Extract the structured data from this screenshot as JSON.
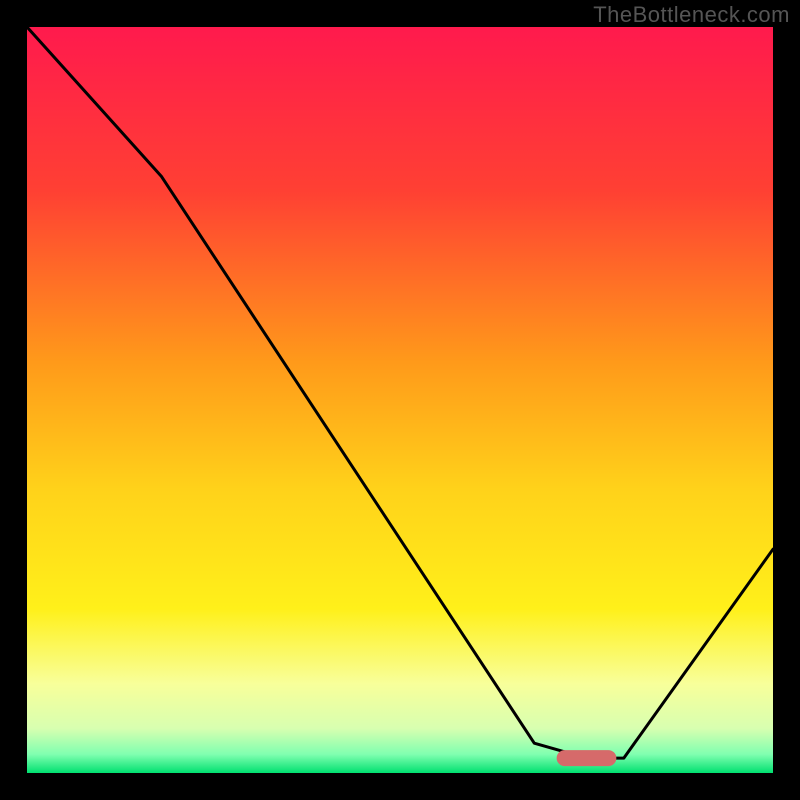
{
  "watermark": "TheBottleneck.com",
  "chart_data": {
    "type": "line",
    "title": "",
    "xlabel": "",
    "ylabel": "",
    "xlim": [
      0,
      100
    ],
    "ylim": [
      0,
      100
    ],
    "x": [
      0,
      18,
      68,
      75,
      80,
      100
    ],
    "values": [
      100,
      80,
      4,
      2,
      2,
      30
    ],
    "marker": {
      "x_start": 71,
      "x_end": 79,
      "y": 2
    },
    "gradient_stops": [
      {
        "offset": 0.0,
        "color": "#ff1a4d"
      },
      {
        "offset": 0.22,
        "color": "#ff4033"
      },
      {
        "offset": 0.45,
        "color": "#ff9a1a"
      },
      {
        "offset": 0.62,
        "color": "#ffd21a"
      },
      {
        "offset": 0.78,
        "color": "#fff01a"
      },
      {
        "offset": 0.88,
        "color": "#f8ff9a"
      },
      {
        "offset": 0.94,
        "color": "#d8ffb0"
      },
      {
        "offset": 0.975,
        "color": "#80ffb0"
      },
      {
        "offset": 1.0,
        "color": "#00e070"
      }
    ]
  }
}
